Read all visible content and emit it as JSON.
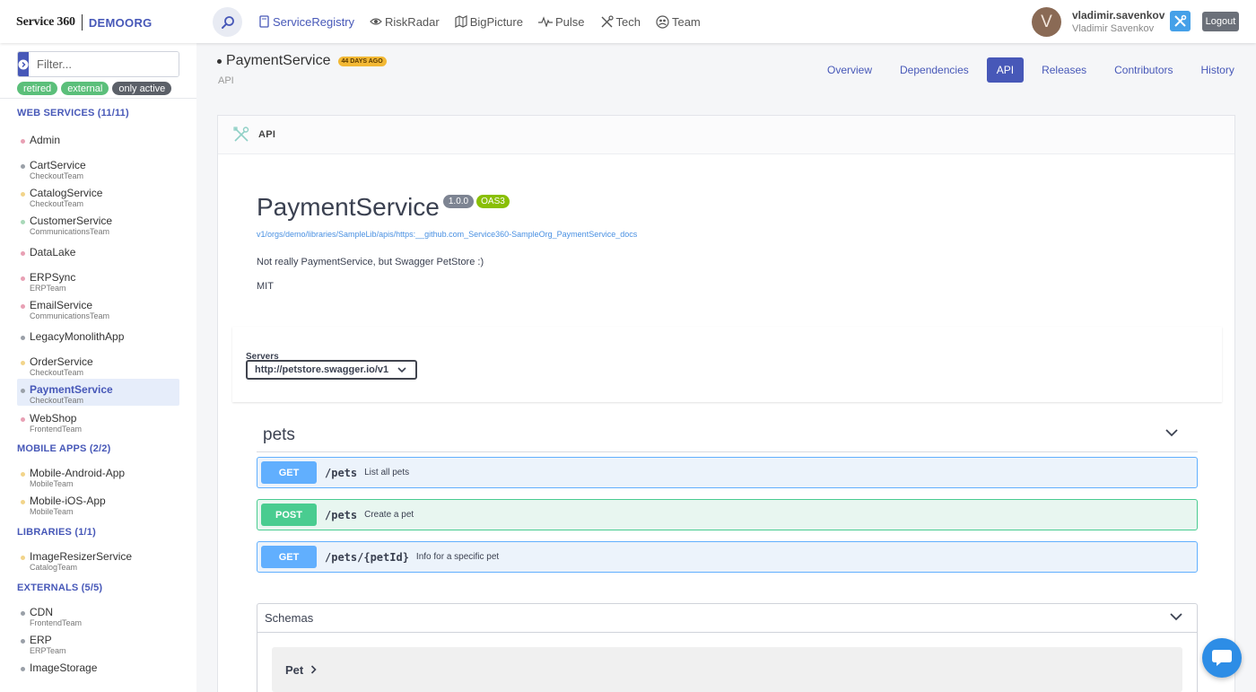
{
  "header": {
    "logo_text": "Service 360",
    "org": "DEMOORG",
    "nav": [
      {
        "label": "ServiceRegistry",
        "icon": "document-icon",
        "active": true
      },
      {
        "label": "RiskRadar",
        "icon": "eye-icon",
        "active": false
      },
      {
        "label": "BigPicture",
        "icon": "map-icon",
        "active": false
      },
      {
        "label": "Pulse",
        "icon": "pulse-icon",
        "active": false
      },
      {
        "label": "Tech",
        "icon": "tools-icon",
        "active": false
      },
      {
        "label": "Team",
        "icon": "team-icon",
        "active": false
      }
    ],
    "user": {
      "initial": "V",
      "login": "vladimir.savenkov",
      "name": "Vladimir Savenkov"
    },
    "logout": "Logout"
  },
  "sidebar": {
    "filter_placeholder": "Filter...",
    "tags": [
      "retired",
      "external",
      "only active"
    ],
    "sections": [
      {
        "title": "WEB SERVICES (11/11)"
      },
      {
        "title": "MOBILE APPS (2/2)"
      },
      {
        "title": "LIBRARIES (1/1)"
      },
      {
        "title": "EXTERNALS (5/5)"
      }
    ],
    "items": [
      {
        "name": "Admin",
        "team": "",
        "color": "#e8a0b4"
      },
      {
        "name": "CartService",
        "team": "CheckoutTeam",
        "color": "#9aa0a8"
      },
      {
        "name": "CatalogService",
        "team": "CheckoutTeam",
        "color": "#f2d48a"
      },
      {
        "name": "CustomerService",
        "team": "CommunicationsTeam",
        "color": "#a8d8b8"
      },
      {
        "name": "DataLake",
        "team": "",
        "color": "#e8a0b4"
      },
      {
        "name": "ERPSync",
        "team": "ERPTeam",
        "color": "#e8a0b4"
      },
      {
        "name": "EmailService",
        "team": "CommunicationsTeam",
        "color": "#e8a0b4"
      },
      {
        "name": "LegacyMonolithApp",
        "team": "",
        "color": "#9aa0a8"
      },
      {
        "name": "OrderService",
        "team": "CheckoutTeam",
        "color": "#f2d48a"
      },
      {
        "name": "PaymentService",
        "team": "CheckoutTeam",
        "color": "#9aa0a8"
      },
      {
        "name": "WebShop",
        "team": "FrontendTeam",
        "color": "#e8a0b4"
      },
      {
        "name": "Mobile-Android-App",
        "team": "MobileTeam",
        "color": "#f2d48a"
      },
      {
        "name": "Mobile-iOS-App",
        "team": "MobileTeam",
        "color": "#f2d48a"
      },
      {
        "name": "ImageResizerService",
        "team": "CatalogTeam",
        "color": "#f2d48a"
      },
      {
        "name": "CDN",
        "team": "FrontendTeam",
        "color": "#9aa0a8"
      },
      {
        "name": "ERP",
        "team": "ERPTeam",
        "color": "#9aa0a8"
      },
      {
        "name": "ImageStorage",
        "team": "",
        "color": "#9aa0a8"
      }
    ]
  },
  "page": {
    "title": "PaymentService",
    "age_badge": "44 DAYS AGO",
    "subtitle": "API",
    "tabs": [
      {
        "label": "Overview",
        "active": false
      },
      {
        "label": "Dependencies",
        "active": false
      },
      {
        "label": "API",
        "active": true
      },
      {
        "label": "Releases",
        "active": false
      },
      {
        "label": "Contributors",
        "active": false
      },
      {
        "label": "History",
        "active": false
      }
    ]
  },
  "card": {
    "header": "API",
    "swagger": {
      "title": "PaymentService",
      "version": "1.0.0",
      "oas": "OAS3",
      "url": "v1/orgs/demo/libraries/SampleLib/apis/https:__github.com_Service360-SampleOrg_PaymentService_docs",
      "description": "Not really PaymentService, but Swagger PetStore :)",
      "license": "MIT",
      "servers_label": "Servers",
      "server_selected": "http://petstore.swagger.io/v1",
      "tag": "pets",
      "operations": [
        {
          "method": "GET",
          "path": "/pets",
          "summary": "List all pets"
        },
        {
          "method": "POST",
          "path": "/pets",
          "summary": "Create a pet"
        },
        {
          "method": "GET",
          "path": "/pets/{petId}",
          "summary": "Info for a specific pet"
        }
      ],
      "schemas_label": "Schemas",
      "schemas": [
        "Pet"
      ]
    }
  },
  "colors": {
    "accent": "#4758b8",
    "get": "#61affe",
    "post": "#49cc90",
    "oas": "#89bf04"
  }
}
